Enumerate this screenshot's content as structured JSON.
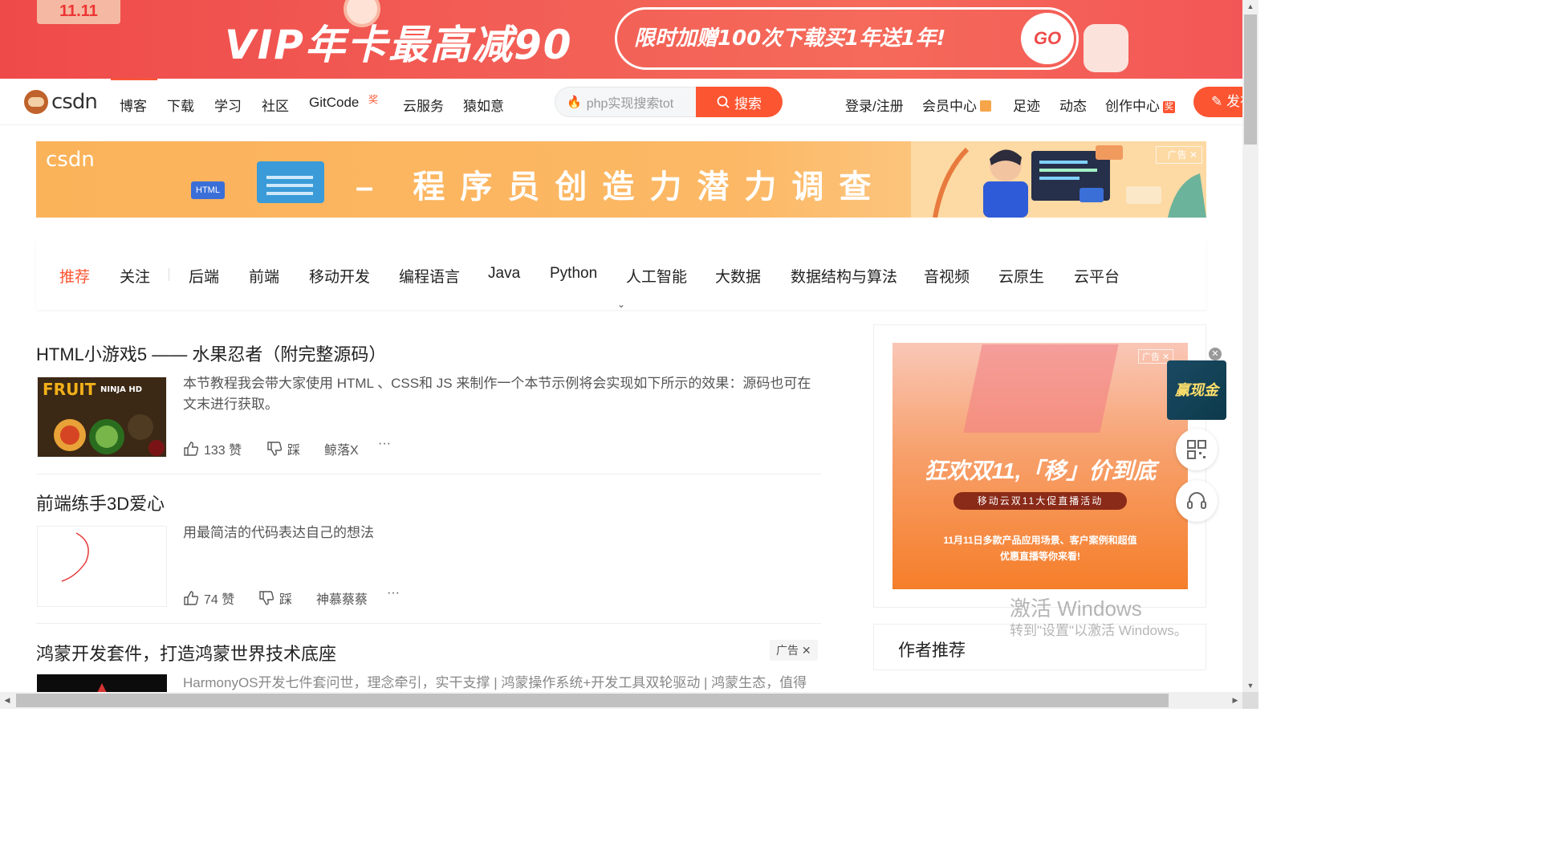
{
  "promo": {
    "badge": "11.11",
    "headline": "VIP年卡最高减90",
    "pill_text": "限时加赠100次下载买1年送1年!",
    "go": "GO"
  },
  "nav": {
    "logo": "csdn",
    "links": [
      "博客",
      "下载",
      "学习",
      "社区",
      "GitCode",
      "云服务",
      "猿如意"
    ],
    "gitcode_badge": "奖",
    "search_placeholder": "php实现搜索tot",
    "search_button": "搜索",
    "right_links": [
      "登录/注册",
      "会员中心",
      "足迹",
      "动态",
      "创作中心"
    ],
    "publish": "发布"
  },
  "adbanner": {
    "brand": "csdn",
    "html_tag": "HTML",
    "slogan": "– 程序员创造力潜力调查 –",
    "close_label": "广告"
  },
  "categories": {
    "items": [
      "推荐",
      "关注",
      "后端",
      "前端",
      "移动开发",
      "编程语言",
      "Java",
      "Python",
      "人工智能",
      "大数据",
      "数据结构与算法",
      "音视频",
      "云原生",
      "云平台"
    ],
    "active": "推荐",
    "more_icon": "chevron-down-icon"
  },
  "articles": [
    {
      "title": "HTML小游戏5 —— 水果忍者（附完整源码）",
      "desc": "本节教程我会带大家使用 HTML 、CSS和 JS 来制作一个本节示例将会实现如下所示的效果：源码也可在文末进行获取。",
      "likes": "133 赞",
      "dislike": "踩",
      "author": "鲸落X",
      "more": "···",
      "thumb_text": "FRUIT NINJA HD"
    },
    {
      "title": "前端练手3D爱心",
      "desc": "用最简洁的代码表达自己的想法",
      "likes": "74 赞",
      "dislike": "踩",
      "author": "神慕蔡蔡",
      "more": "···"
    },
    {
      "title": "鸿蒙开发套件，打造鸿蒙世界技术底座",
      "desc": "HarmonyOS开发七件套问世，理念牵引，实干支撑 | 鸿蒙操作系统+开发工具双轮驱动 | 鸿蒙生态，值得",
      "ad_tag": "广告 ✕"
    }
  ],
  "right_ad": {
    "tag": "广告",
    "headline": "狂欢双11,「移」价到底",
    "sub": "移动云双11大促直播活动",
    "desc_lines": [
      "11月11日多款产品应用场景、客户案例和超值",
      "优惠直播等你来看!"
    ]
  },
  "author_panel": {
    "title": "作者推荐"
  },
  "float": {
    "ad_text": "赢现金",
    "close": "✕"
  },
  "watermark": {
    "line1": "激活 Windows",
    "line2": "转到\"设置\"以激活 Windows。"
  },
  "colors": {
    "accent": "#fc5531",
    "promo_bg": "#ef4a4a",
    "adbanner_bg": "#fbb35a"
  }
}
